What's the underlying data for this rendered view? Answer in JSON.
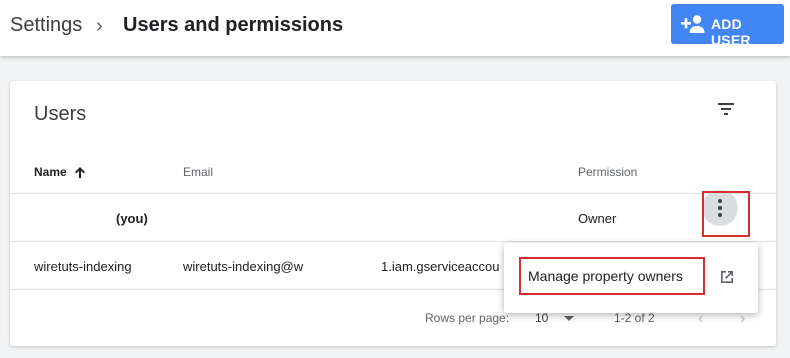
{
  "header": {
    "breadcrumb_root": "Settings",
    "breadcrumb_sep": "›",
    "title": "Users and permissions",
    "add_user_label": "ADD USER",
    "add_user_icon": "person-add-icon"
  },
  "users_card": {
    "title": "Users",
    "filter_icon": "filter-list-icon",
    "columns": {
      "name": "Name",
      "email": "Email",
      "permission": "Permission"
    },
    "sort_icon": "arrow-up-icon",
    "rows": [
      {
        "name": "(you)",
        "email": "",
        "email_tail": "",
        "permission": "Owner"
      },
      {
        "name": "wiretuts-indexing",
        "email": "wiretuts-indexing@w",
        "email_tail": "1.iam.gserviceaccou",
        "permission": ""
      }
    ],
    "row_menu_icon": "more-vert-icon",
    "menu": {
      "item_label": "Manage property owners",
      "item_icon": "open-in-new-icon"
    },
    "pagination": {
      "rows_per_page_label": "Rows per page:",
      "rows_per_page_value": "10",
      "range": "1-2 of 2",
      "prev_icon": "chevron-left-icon",
      "next_icon": "chevron-right-icon"
    }
  },
  "colors": {
    "primary": "#4285f4",
    "highlight_box": "#d32f2f",
    "background": "#f1f3f4"
  }
}
